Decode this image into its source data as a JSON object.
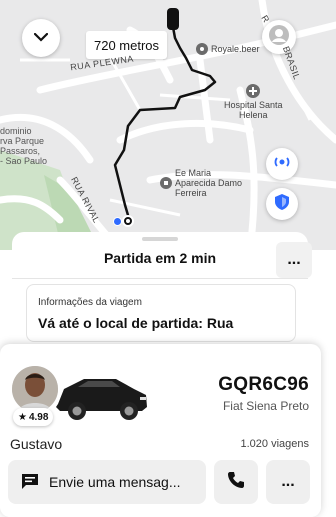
{
  "map": {
    "distance": "720 metros",
    "streets": [
      "RUA PLEWNA",
      "RUA RIVAL"
    ],
    "street_partial_top": "R",
    "street_partial_right": "BRASIL",
    "pois": [
      {
        "label": "Royale.beer",
        "icon": "pin-icon"
      },
      {
        "label": "Hospital Santa\nHelena",
        "icon": "hospital-icon"
      },
      {
        "label": "Ee Maria\nAparecida Damo\nFerreira",
        "icon": "school-icon"
      }
    ],
    "area_label": "dominio\nrva Parque\nPassaros,\n- Sao Paulo",
    "accent": "#2F6BFF"
  },
  "sheet": {
    "departure": "Partida em 2 min",
    "trip_caption": "Informações da viagem",
    "trip_title": "Vá até o local de partida: Rua",
    "trip_more": "..."
  },
  "driver": {
    "rating": "4.98",
    "plate": "GQR6C96",
    "car_model": "Fiat Siena Preto",
    "name": "Gustavo",
    "trips": "1.020 viagens",
    "message_placeholder": "Envie uma mensag...",
    "more": "..."
  }
}
